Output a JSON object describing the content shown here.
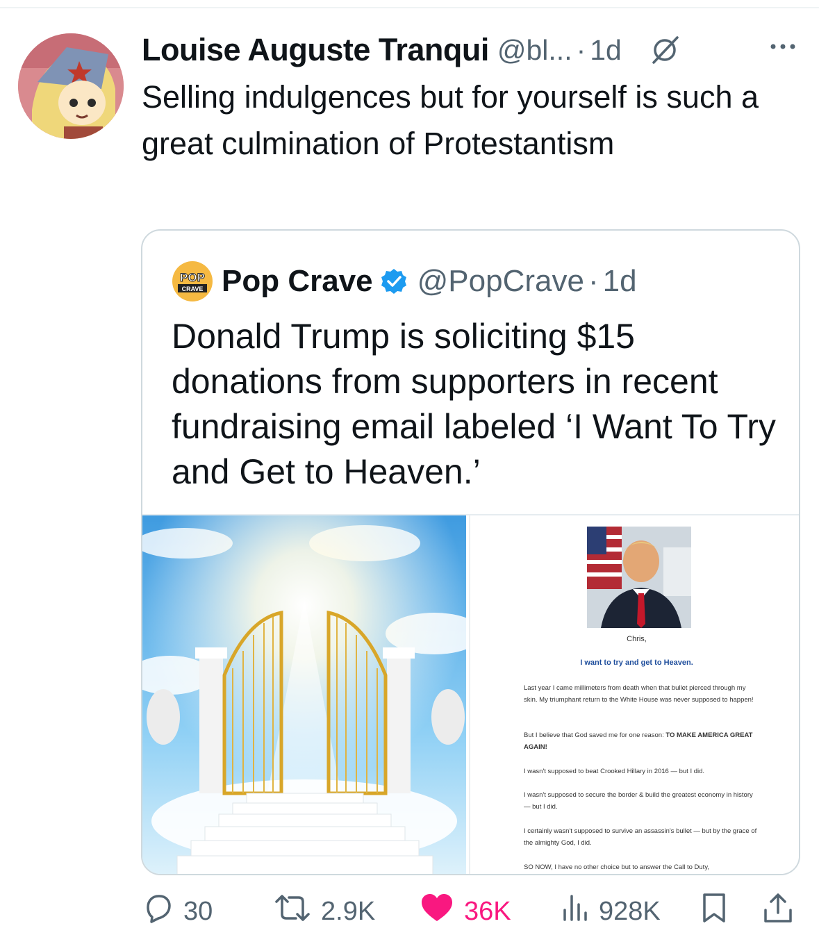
{
  "tweet": {
    "author_name": "Louise Auguste Tranqui",
    "author_handle": "@bl...",
    "separator": "·",
    "time": "1d",
    "text": "Selling indulgences but for yourself is such a great culmination of Protestantism"
  },
  "quoted": {
    "logo_text_top": "POP",
    "logo_text_bottom": "CRAVE",
    "author_name": "Pop Crave",
    "author_handle": "@PopCrave",
    "separator": "·",
    "time": "1d",
    "text": "Donald Trump is soliciting $15 donations from supporters in recent fundraising email labeled ‘I Want To Try and Get to Heaven.’",
    "email": {
      "greeting": "Chris,",
      "subject": "I want to try and get to Heaven.",
      "p1": "Last year I came millimeters from death when that bullet pierced through my skin. My triumphant return to the White House was never supposed to happen!",
      "p2_plain": "But I believe that God saved me for one reason: ",
      "p2_bold": "TO MAKE AMERICA GREAT AGAIN!",
      "p3": "I wasn't supposed to beat Crooked Hillary in 2016 — but I did.",
      "p4": "I wasn't supposed to secure the border & build the greatest economy in history — but I did.",
      "p5": "I certainly wasn't supposed to survive an assassin's bullet — but by the grace of the almighty God, I did.",
      "p6": "SO NOW, I have no other choice but to answer the Call to Duty,"
    }
  },
  "actions": {
    "replies": "30",
    "reposts": "2.9K",
    "likes": "36K",
    "views": "928K"
  },
  "colors": {
    "like": "#f91880",
    "verified": "#1d9bf0",
    "muted": "#536471"
  },
  "icons": [
    "grok-icon",
    "more-icon",
    "verified-icon",
    "reply-icon",
    "repost-icon",
    "heart-icon",
    "views-icon",
    "bookmark-icon",
    "share-icon"
  ]
}
